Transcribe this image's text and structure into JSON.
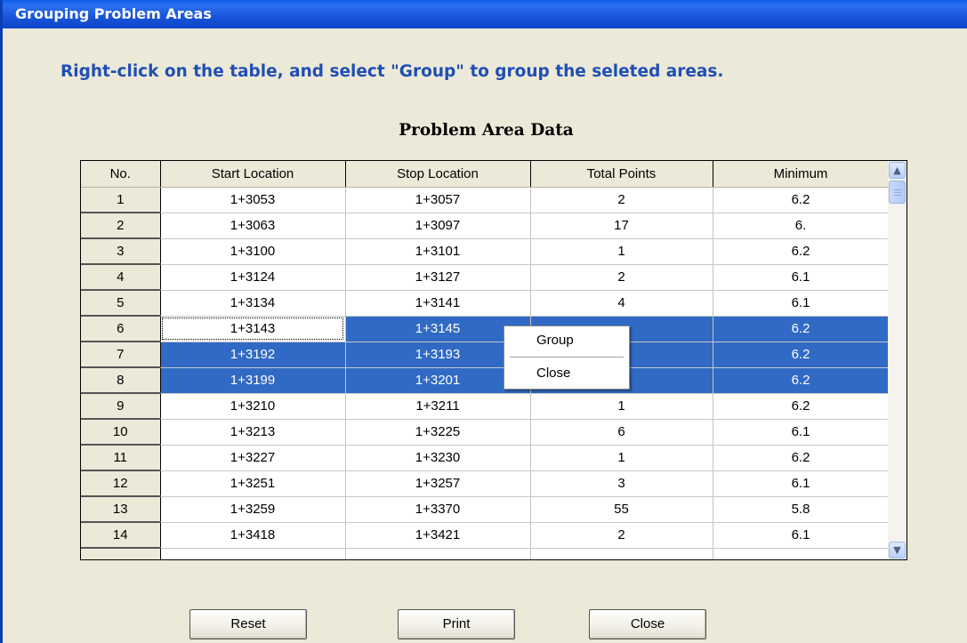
{
  "window": {
    "title": "Grouping Problem Areas"
  },
  "instructions": "Right-click on the table, and select \"Group\" to group the seleted areas.",
  "table": {
    "title": "Problem Area Data",
    "columns": [
      "No.",
      "Start Location",
      "Stop Location",
      "Total Points",
      "Minimum"
    ],
    "rows": [
      [
        "1",
        "1+3053",
        "1+3057",
        "2",
        "6.2"
      ],
      [
        "2",
        "1+3063",
        "1+3097",
        "17",
        "6."
      ],
      [
        "3",
        "1+3100",
        "1+3101",
        "1",
        "6.2"
      ],
      [
        "4",
        "1+3124",
        "1+3127",
        "2",
        "6.1"
      ],
      [
        "5",
        "1+3134",
        "1+3141",
        "4",
        "6.1"
      ],
      [
        "6",
        "1+3143",
        "1+3145",
        "",
        "6.2"
      ],
      [
        "7",
        "1+3192",
        "1+3193",
        "",
        "6.2"
      ],
      [
        "8",
        "1+3199",
        "1+3201",
        "",
        "6.2"
      ],
      [
        "9",
        "1+3210",
        "1+3211",
        "1",
        "6.2"
      ],
      [
        "10",
        "1+3213",
        "1+3225",
        "6",
        "6.1"
      ],
      [
        "11",
        "1+3227",
        "1+3230",
        "1",
        "6.2"
      ],
      [
        "12",
        "1+3251",
        "1+3257",
        "3",
        "6.1"
      ],
      [
        "13",
        "1+3259",
        "1+3370",
        "55",
        "5.8"
      ],
      [
        "14",
        "1+3418",
        "1+3421",
        "2",
        "6.1"
      ]
    ],
    "selected_rows": [
      6,
      7,
      8
    ]
  },
  "context_menu": {
    "items": [
      "Group",
      "Close"
    ]
  },
  "buttons": {
    "reset": "Reset",
    "print": "Print",
    "close": "Close"
  },
  "icons": {
    "scroll_up": "chevron-up-icon",
    "scroll_down": "chevron-down-icon"
  },
  "colors": {
    "title_bar": "#0a5fe9",
    "selection": "#316ac5",
    "instruction_text": "#1f4fb5",
    "window_bg": "#ece9d8"
  }
}
